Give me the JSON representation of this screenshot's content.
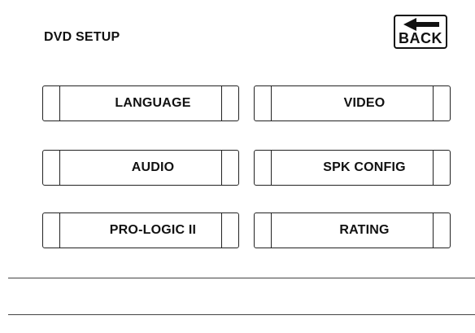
{
  "header": {
    "title": "DVD SETUP",
    "back_label": "BACK",
    "back_icon": "left-arrow-icon"
  },
  "menu": {
    "items": [
      {
        "label": "LANGUAGE"
      },
      {
        "label": "VIDEO"
      },
      {
        "label": "AUDIO"
      },
      {
        "label": "SPK CONFIG"
      },
      {
        "label": "PRO-LOGIC II"
      },
      {
        "label": "RATING"
      }
    ]
  },
  "colors": {
    "background": "#ffffff",
    "foreground": "#111111"
  }
}
